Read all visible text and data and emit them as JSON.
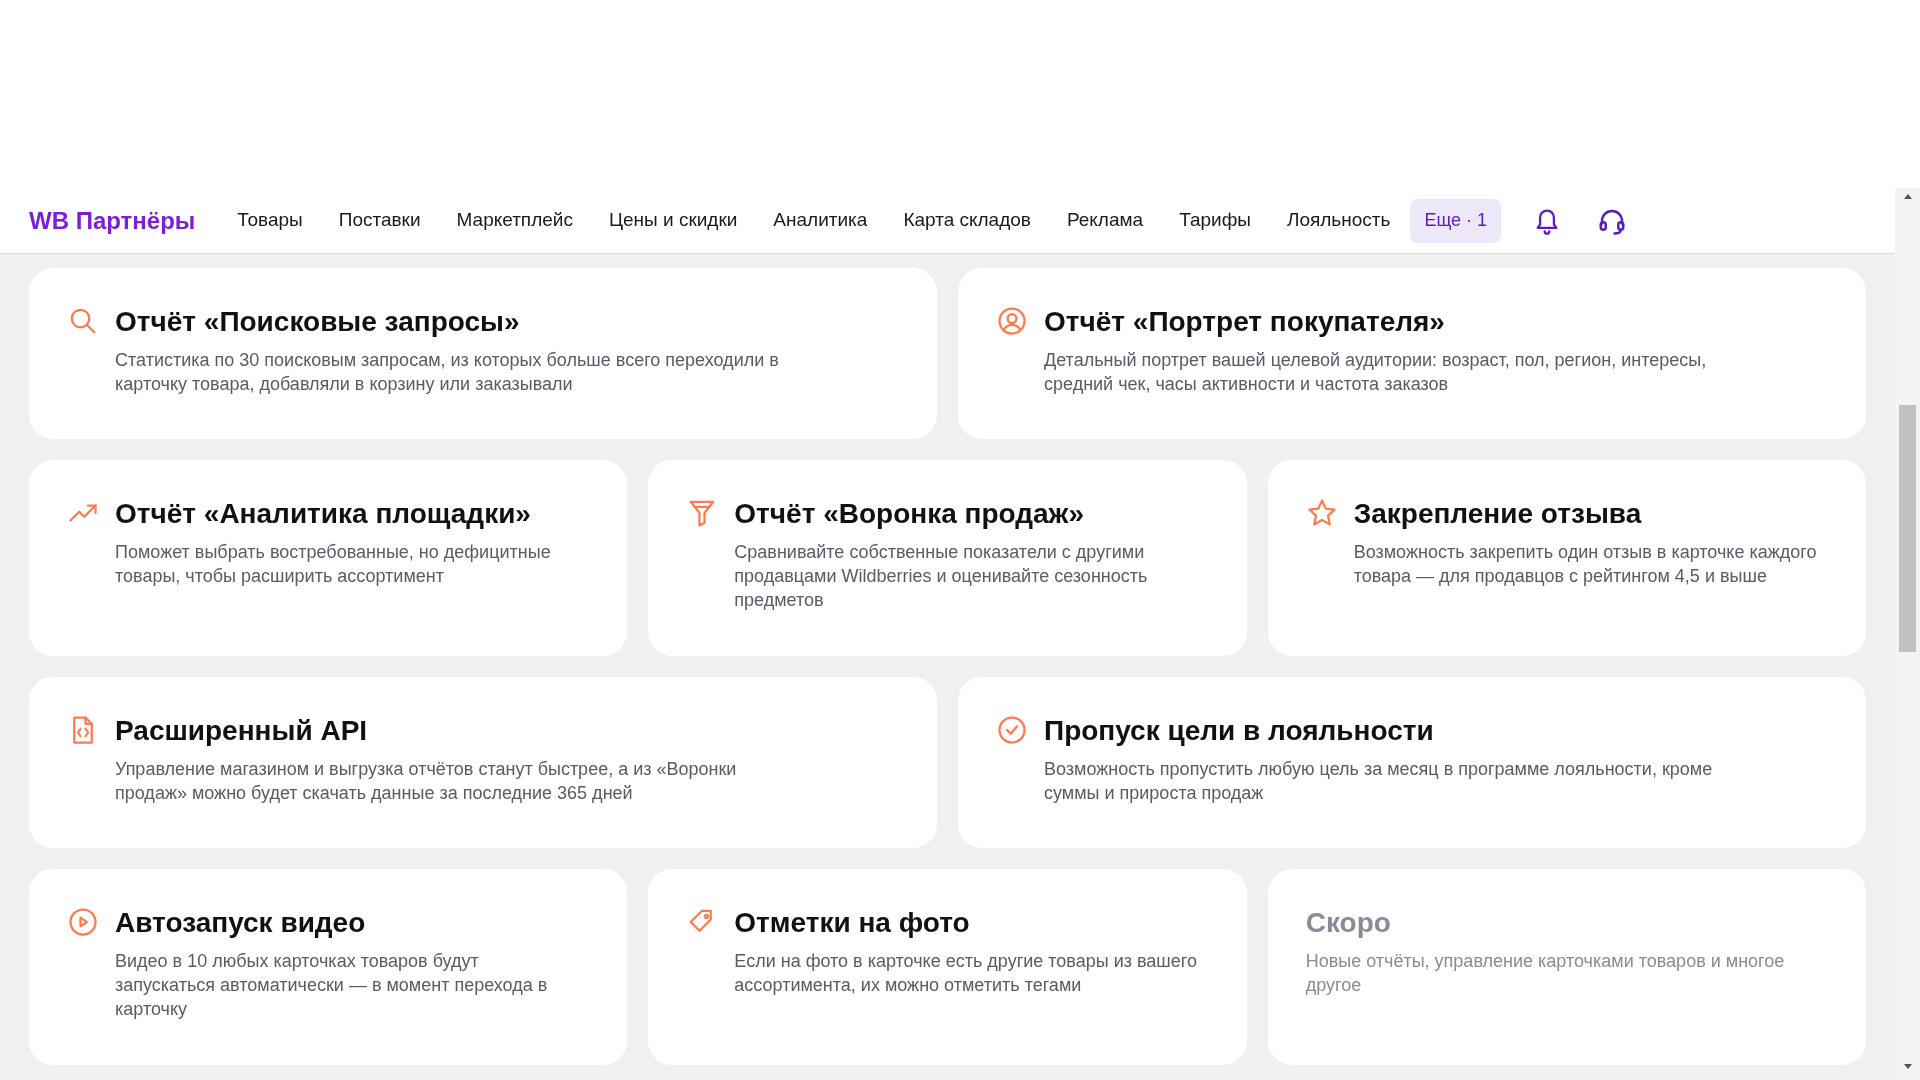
{
  "header": {
    "logo": "WB Партнёры",
    "nav": [
      {
        "label": "Товары",
        "selected": false
      },
      {
        "label": "Поставки",
        "selected": false
      },
      {
        "label": "Маркетплейс",
        "selected": false
      },
      {
        "label": "Цены и скидки",
        "selected": false
      },
      {
        "label": "Аналитика",
        "selected": false
      },
      {
        "label": "Карта складов",
        "selected": false
      },
      {
        "label": "Реклама",
        "selected": false
      },
      {
        "label": "Тарифы",
        "selected": false
      },
      {
        "label": "Лояльность",
        "selected": false
      }
    ],
    "more_button": "Еще · 1"
  },
  "rows": [
    {
      "cards": [
        {
          "kind": "feature",
          "title": "Отчёт «Поисковые запросы»",
          "description": "Статистика по 30 поисковым запросам, из которых больше всего переходили в карточку товара, добавляли в корзину или заказывали"
        },
        {
          "kind": "feature",
          "title": "Отчёт «Портрет покупателя»",
          "description": "Детальный портрет вашей целевой аудитории: возраст, пол, регион, интересы, средний чек, часы активности и частота заказов"
        }
      ]
    },
    {
      "cards": [
        {
          "kind": "feature",
          "title": "Отчёт «Аналитика площадки»",
          "description": "Поможет выбрать востребованные, но дефицитные товары, чтобы расширить ассортимент"
        },
        {
          "kind": "feature",
          "title": "Отчёт «Воронка продаж»",
          "description": "Сравнивайте собственные показатели с другими продавцами Wildberries и оценивайте сезонность предметов"
        },
        {
          "kind": "feature",
          "title": "Закрепление отзыва",
          "description": "Возможность закрепить один отзыв в карточке каждого товара — для продавцов с рейтингом 4,5 и выше"
        }
      ]
    },
    {
      "cards": [
        {
          "kind": "feature",
          "title": "Расширенный API",
          "description": "Управление магазином и выгрузка отчётов станут быстрее, а из «Воронки продаж» можно будет скачать данные за последние 365 дней"
        },
        {
          "kind": "feature",
          "title": "Пропуск цели в лояльности",
          "description": "Возможность пропустить любую цель за месяц в программе лояльности, кроме суммы и прироста продаж"
        }
      ]
    },
    {
      "cards": [
        {
          "kind": "feature",
          "title": "Автозапуск видео",
          "description": "Видео в 10 любых карточках товаров будут запускаться автоматически — в момент перехода в карточку"
        },
        {
          "kind": "feature",
          "title": "Отметки на фото",
          "description": "Если на фото в карточке есть другие товары из вашего ассортимента, их можно отметить тегами"
        },
        {
          "kind": "soon",
          "title": "Скоро",
          "description": "Новые отчёты, управление карточками товаров и многое другое"
        }
      ]
    }
  ]
}
